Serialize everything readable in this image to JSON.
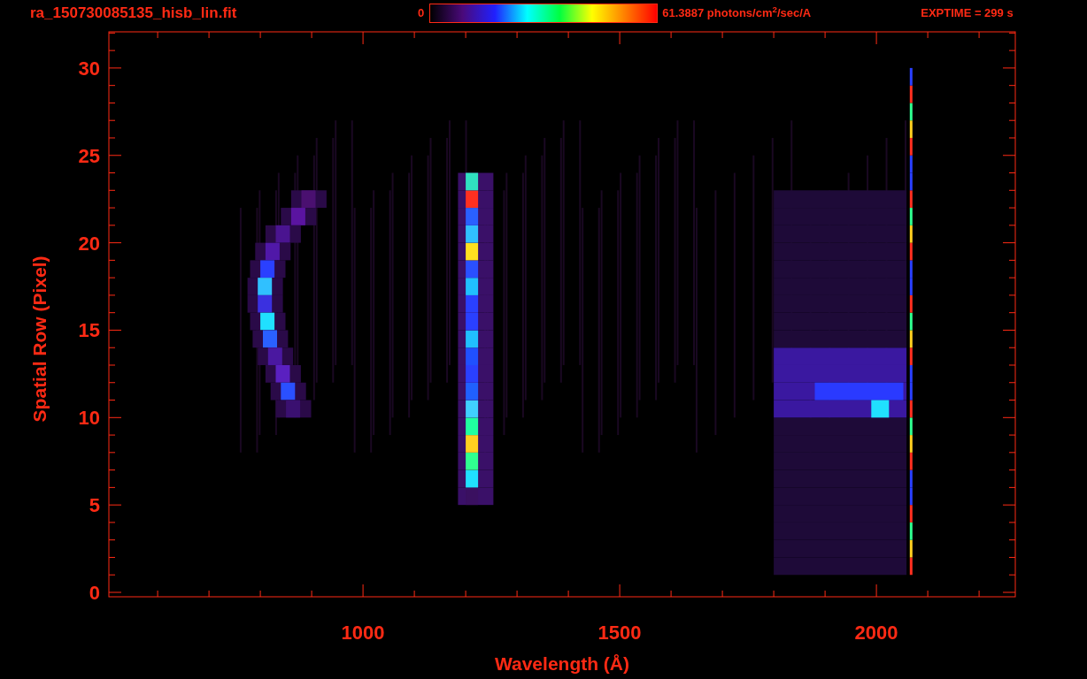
{
  "header": {
    "filename": "ra_150730085135_hisb_lin.fit",
    "colorbar": {
      "min_label": "0",
      "max_label": "61.3887 photons/cm$^{2}$/sec/A"
    },
    "exposure": "EXPTIME = 299 s"
  },
  "plot": {
    "xlabel": "Wavelength (Å)",
    "ylabel": "Spatial Row (Pixel)",
    "xticks": [
      "1000",
      "1500",
      "2000"
    ],
    "yticks": [
      "30",
      "25",
      "20",
      "15",
      "10",
      "5",
      "0"
    ]
  }
}
